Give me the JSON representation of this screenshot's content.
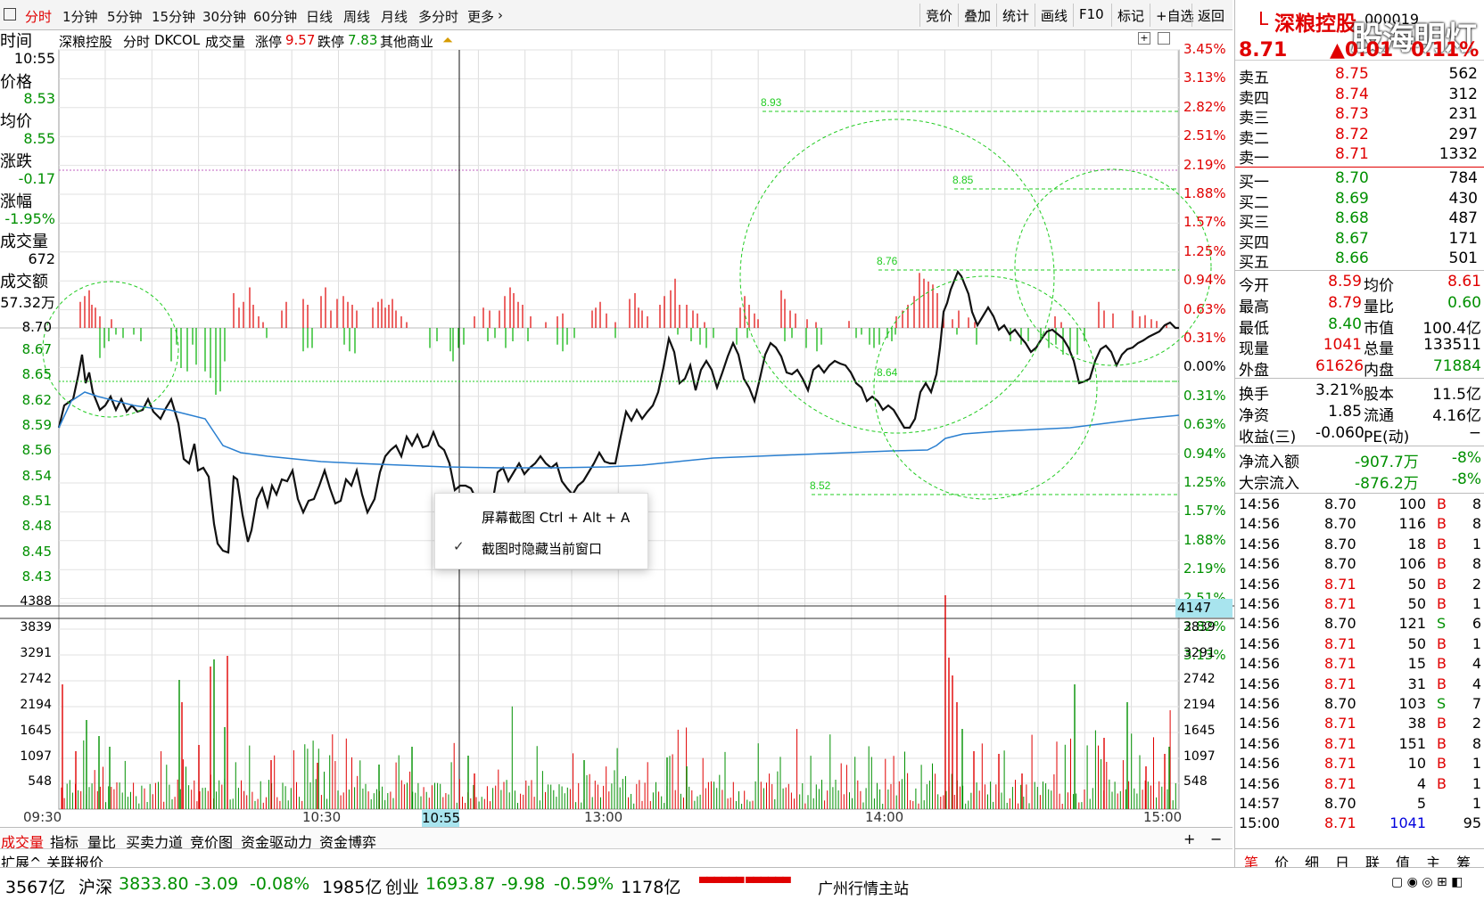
{
  "toolbar": {
    "tabs": [
      "分时",
      "1分钟",
      "5分钟",
      "15分钟",
      "30分钟",
      "60分钟",
      "日线",
      "周线",
      "月线",
      "多分时",
      "更多"
    ],
    "right": [
      "竞价",
      "叠加",
      "统计",
      "画线",
      "F10",
      "标记",
      "+自选",
      "返回"
    ]
  },
  "info_bar": {
    "name": "深粮控股",
    "mode": "分时",
    "indicator": "DKCOL",
    "vol": "成交量",
    "limit_up_label": "涨停",
    "limit_up": "9.57",
    "limit_down_label": "跌停",
    "limit_down": "7.83",
    "sector": "其他商业"
  },
  "left_info": {
    "time_label": "时间",
    "time": "10:55",
    "price_label": "价格",
    "price": "8.53",
    "avg_label": "均价",
    "avg": "8.55",
    "chg_label": "涨跌",
    "chg": "-0.17",
    "pct_label": "涨幅",
    "pct": "-1.95%",
    "vol_label": "成交量",
    "vol": "672",
    "amt_label": "成交额",
    "amt": "57.32万"
  },
  "price_axis": [
    "8.70",
    "8.67",
    "8.65",
    "8.62",
    "8.59",
    "8.56",
    "8.54",
    "8.51",
    "8.48",
    "8.45",
    "8.43"
  ],
  "pct_axis": [
    "3.45%",
    "3.13%",
    "2.82%",
    "2.51%",
    "2.19%",
    "1.88%",
    "1.57%",
    "1.25%",
    "0.94%",
    "0.63%",
    "0.31%",
    "0.00%",
    "0.31%",
    "0.63%",
    "0.94%",
    "1.25%",
    "1.57%",
    "1.88%",
    "2.19%",
    "2.51%",
    "2.82%",
    "3.13%"
  ],
  "vol_axis": [
    "4388",
    "3839",
    "3291",
    "2742",
    "2194",
    "1645",
    "1097",
    "548"
  ],
  "vol_axis_right_top": "4147",
  "vol_axis_right": [
    "3839",
    "3291",
    "2742",
    "2194",
    "1645",
    "1097",
    "548"
  ],
  "time_axis": [
    "09:30",
    "10:30",
    "13:00",
    "14:00",
    "15:00"
  ],
  "cursor_time": "10:55",
  "annotations": [
    "8.93",
    "8.85",
    "8.76",
    "8.64",
    "8.52"
  ],
  "context_menu": {
    "item1": "屏幕截图 Ctrl + Alt + A",
    "item2": "截图时隐藏当前窗口",
    "check": "✓"
  },
  "bottom_tabs": [
    "成交量",
    "指标",
    "量比",
    "买卖力道",
    "竞价图",
    "资金驱动力",
    "资金博弈"
  ],
  "bottom_tabs2": [
    "扩展^",
    "关联报价"
  ],
  "bottom_controls": [
    "+",
    "−"
  ],
  "quote": {
    "prefix": "L",
    "name": "深粮控股",
    "code": "000019",
    "watermark": "股海明灯",
    "price": "8.71",
    "change": "▲0.01",
    "pct": "0.11%",
    "asks": [
      {
        "l": "卖五",
        "p": "8.75",
        "v": "562"
      },
      {
        "l": "卖四",
        "p": "8.74",
        "v": "312"
      },
      {
        "l": "卖三",
        "p": "8.73",
        "v": "231"
      },
      {
        "l": "卖二",
        "p": "8.72",
        "v": "297"
      },
      {
        "l": "卖一",
        "p": "8.71",
        "v": "1332"
      }
    ],
    "bids": [
      {
        "l": "买一",
        "p": "8.70",
        "v": "784"
      },
      {
        "l": "买二",
        "p": "8.69",
        "v": "430"
      },
      {
        "l": "买三",
        "p": "8.68",
        "v": "487"
      },
      {
        "l": "买四",
        "p": "8.67",
        "v": "171"
      },
      {
        "l": "买五",
        "p": "8.66",
        "v": "501"
      }
    ],
    "stats": [
      [
        "今开",
        "8.59",
        "均价",
        "8.61"
      ],
      [
        "最高",
        "8.79",
        "量比",
        "0.60"
      ],
      [
        "最低",
        "8.40",
        "市值",
        "100.4亿"
      ],
      [
        "现量",
        "1041",
        "总量",
        "133511"
      ],
      [
        "外盘",
        "61626",
        "内盘",
        "71884"
      ],
      [
        "换手",
        "3.21%",
        "股本",
        "11.5亿"
      ],
      [
        "净资",
        "1.85",
        "流通",
        "4.16亿"
      ],
      [
        "收益(三)",
        "-0.060",
        "PE(动)",
        "−"
      ]
    ],
    "flows": [
      [
        "净流入额",
        "-907.7万",
        "-8%"
      ],
      [
        "大宗流入",
        "-876.2万",
        "-8%"
      ]
    ],
    "ticks": [
      [
        "14:56",
        "8.70",
        "100",
        "B",
        "8"
      ],
      [
        "14:56",
        "8.70",
        "116",
        "B",
        "8"
      ],
      [
        "14:56",
        "8.70",
        "18",
        "B",
        "1"
      ],
      [
        "14:56",
        "8.70",
        "106",
        "B",
        "8"
      ],
      [
        "14:56",
        "8.71",
        "50",
        "B",
        "2"
      ],
      [
        "14:56",
        "8.71",
        "50",
        "B",
        "1"
      ],
      [
        "14:56",
        "8.70",
        "121",
        "S",
        "6"
      ],
      [
        "14:56",
        "8.71",
        "50",
        "B",
        "1"
      ],
      [
        "14:56",
        "8.71",
        "15",
        "B",
        "4"
      ],
      [
        "14:56",
        "8.71",
        "31",
        "B",
        "4"
      ],
      [
        "14:56",
        "8.70",
        "103",
        "S",
        "7"
      ],
      [
        "14:56",
        "8.71",
        "38",
        "B",
        "2"
      ],
      [
        "14:56",
        "8.71",
        "151",
        "B",
        "8"
      ],
      [
        "14:56",
        "8.71",
        "10",
        "B",
        "1"
      ],
      [
        "14:56",
        "8.71",
        "4",
        "B",
        "1"
      ],
      [
        "14:57",
        "8.70",
        "5",
        "",
        "1"
      ],
      [
        "15:00",
        "8.71",
        "1041",
        "",
        "95"
      ]
    ],
    "tabs": [
      "笔",
      "价",
      "细",
      "日",
      "联",
      "值",
      "主",
      "筹"
    ]
  },
  "status": {
    "amt1": "3567亿",
    "idx1_name": "沪深",
    "idx1": "3833.80",
    "idx1_chg": "-3.09",
    "idx1_pct": "-0.08%",
    "amt2": "1985亿",
    "idx2_name": "创业",
    "idx2": "1693.87",
    "idx2_chg": "-9.98",
    "idx2_pct": "-0.59%",
    "amt3": "1178亿",
    "station": "广州行情主站"
  },
  "colors": {
    "up": "#e00000",
    "down": "#009000",
    "price_line": "#111111",
    "avg_line": "#2a7fd0",
    "annot": "#22cc22"
  }
}
